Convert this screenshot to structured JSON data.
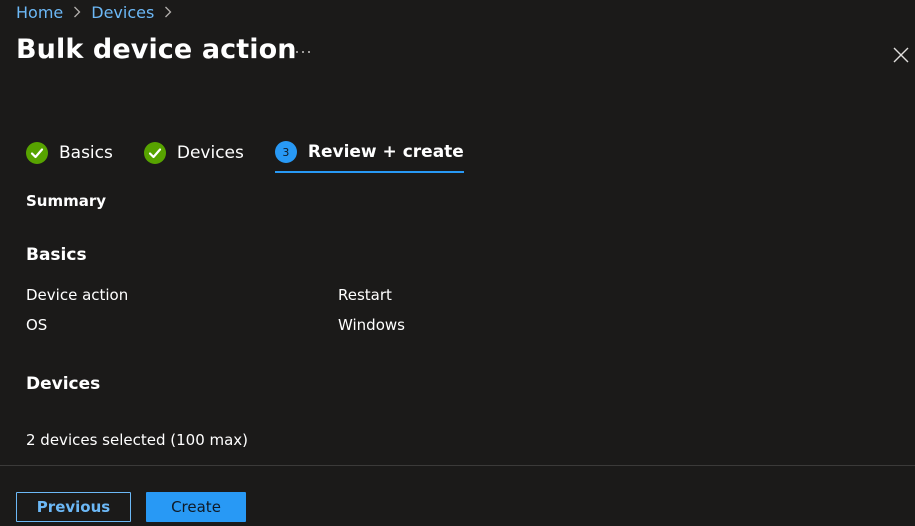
{
  "breadcrumb": {
    "items": [
      "Home",
      "Devices"
    ]
  },
  "header": {
    "title": "Bulk device action",
    "more_label": "···"
  },
  "steps": [
    {
      "label": "Basics",
      "state": "complete"
    },
    {
      "label": "Devices",
      "state": "complete"
    },
    {
      "label": "Review + create",
      "state": "active",
      "number": "3"
    }
  ],
  "summary": {
    "label": "Summary",
    "basics": {
      "heading": "Basics",
      "rows": [
        {
          "key": "Device action",
          "value": "Restart"
        },
        {
          "key": "OS",
          "value": "Windows"
        }
      ]
    },
    "devices": {
      "heading": "Devices",
      "text": "2 devices selected (100 max)"
    }
  },
  "footer": {
    "previous_label": "Previous",
    "create_label": "Create"
  },
  "colors": {
    "background": "#1b1a19",
    "link": "#6cb8f6",
    "accent": "#2899f5",
    "success": "#57a300"
  }
}
